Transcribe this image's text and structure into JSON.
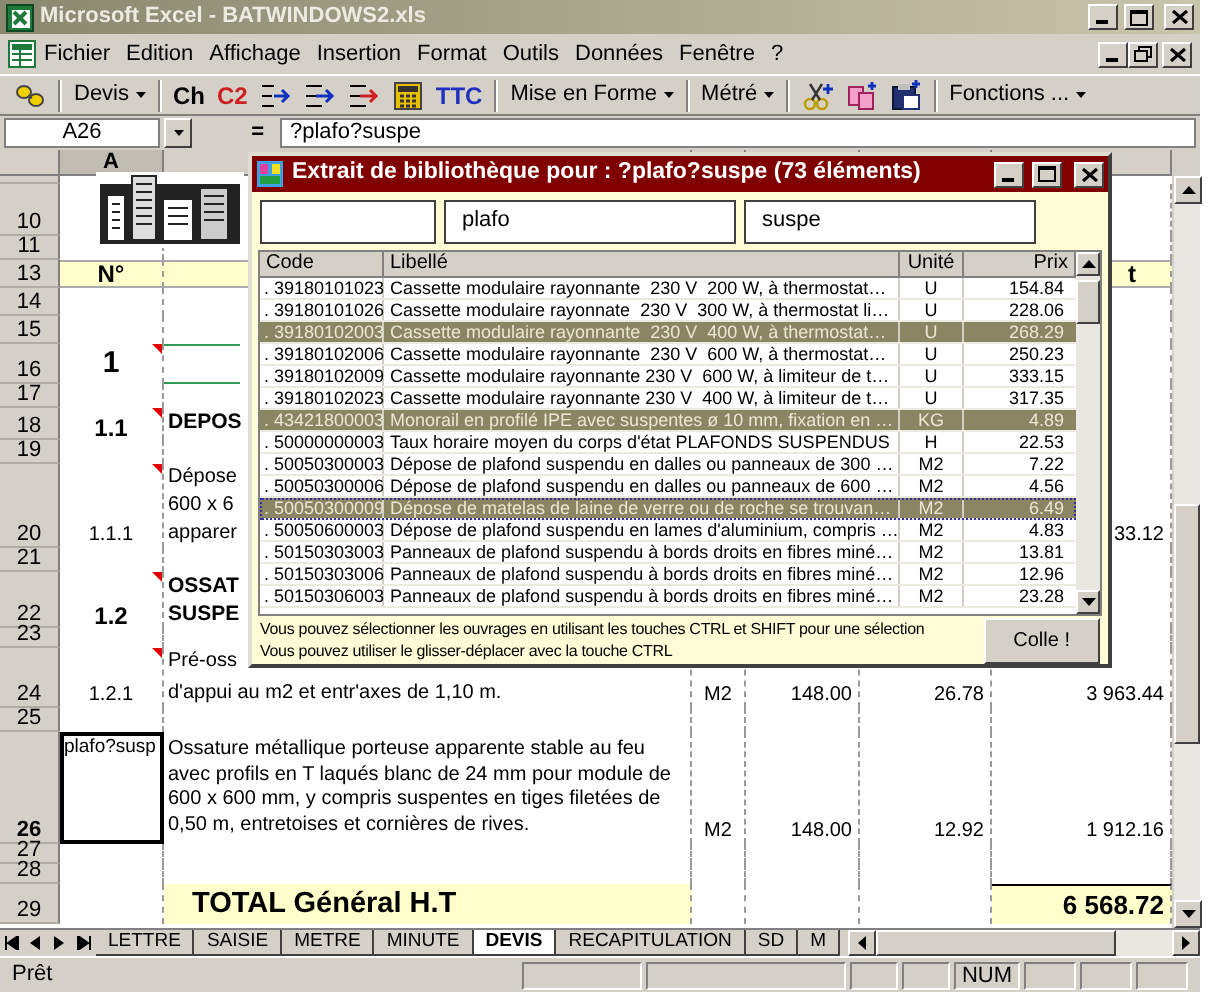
{
  "window": {
    "title": "Microsoft Excel - BATWINDOWS2.xls"
  },
  "menu": [
    "Fichier",
    "Edition",
    "Affichage",
    "Insertion",
    "Format",
    "Outils",
    "Données",
    "Fenêtre",
    "?"
  ],
  "toolbar": [
    {
      "kind": "icon"
    },
    {
      "kind": "separator"
    },
    {
      "kind": "dropdown",
      "label": "Devis"
    },
    {
      "kind": "separator"
    },
    {
      "kind": "text",
      "label": "Ch",
      "color": "#000000"
    },
    {
      "kind": "text",
      "label": "C2",
      "color": "#cc2020"
    },
    {
      "kind": "icon"
    },
    {
      "kind": "icon"
    },
    {
      "kind": "icon"
    },
    {
      "kind": "icon"
    },
    {
      "kind": "text",
      "label": "TTC",
      "color": "#2030c0"
    },
    {
      "kind": "separator"
    },
    {
      "kind": "dropdown",
      "label": "Mise en Forme"
    },
    {
      "kind": "separator"
    },
    {
      "kind": "dropdown",
      "label": "Métré"
    },
    {
      "kind": "separator"
    },
    {
      "kind": "icon"
    },
    {
      "kind": "icon"
    },
    {
      "kind": "icon"
    },
    {
      "kind": "separator"
    },
    {
      "kind": "dropdown",
      "label": "Fonctions ..."
    }
  ],
  "formula_bar": {
    "name_box": "A26",
    "equals": "=",
    "value": "?plafo?suspe"
  },
  "columns": [
    {
      "label": "A",
      "selected": true
    }
  ],
  "rows": [
    {
      "num": "10",
      "kind": "blank",
      "selected": false,
      "note": false
    },
    {
      "num": "11",
      "kind": "blank",
      "selected": false,
      "note": false
    },
    {
      "num": "13",
      "kind": "header",
      "selected": false,
      "note": false,
      "a": "N°",
      "f": "t"
    },
    {
      "num": "14",
      "kind": "blank",
      "selected": false,
      "note": false
    },
    {
      "num": "15",
      "kind": "blank",
      "selected": false,
      "note": false
    },
    {
      "num": "16",
      "kind": "chapter",
      "selected": false,
      "note": true,
      "a": "1"
    },
    {
      "num": "17",
      "kind": "blank",
      "selected": false,
      "note": false
    },
    {
      "num": "18",
      "kind": "section",
      "selected": false,
      "note": true,
      "a": "1.1",
      "lines": [
        "DEPOS"
      ]
    },
    {
      "num": "19",
      "kind": "blank",
      "selected": false,
      "note": false
    },
    {
      "num": "20",
      "kind": "item",
      "selected": false,
      "note": true,
      "a": "1.1.1",
      "lines": [
        "Dépose",
        "600 x 6",
        "apparer"
      ],
      "f": "33.12"
    },
    {
      "num": "21",
      "kind": "blank",
      "selected": false,
      "note": false
    },
    {
      "num": "22",
      "kind": "section",
      "selected": false,
      "note": true,
      "a": "1.2",
      "lines": [
        "OSSAT",
        "SUSPE"
      ]
    },
    {
      "num": "23",
      "kind": "blank",
      "selected": false,
      "note": false
    },
    {
      "num": "24",
      "kind": "item",
      "selected": false,
      "note": true,
      "a": "1.2.1",
      "lines": [
        "Pré-oss",
        "d'appui au m2 et entr'axes de 1,10 m."
      ],
      "c": "M2",
      "d": "148.00",
      "e": "26.78",
      "f": "3 963.44"
    },
    {
      "num": "25",
      "kind": "blank",
      "selected": false,
      "note": false
    },
    {
      "num": "26",
      "kind": "item",
      "selected": true,
      "note": false,
      "a": "plafo?susp",
      "text": "Ossature métallique porteuse apparente stable au feu avec profils en T laqués blanc de 24 mm pour module de 600 x 600 mm, y compris suspentes en tiges filetées de 0,50 m, entretoises et cornières de rives.",
      "c": "M2",
      "d": "148.00",
      "e": "12.92",
      "f": "1 912.16"
    },
    {
      "num": "27",
      "kind": "blank",
      "selected": false,
      "note": false
    },
    {
      "num": "28",
      "kind": "blank",
      "selected": false,
      "note": false
    },
    {
      "num": "29",
      "kind": "total",
      "selected": false,
      "note": false,
      "text": "TOTAL Général H.T",
      "f": "6 568.72"
    }
  ],
  "sheet_tabs": [
    {
      "label": "LETTRE",
      "selected": false
    },
    {
      "label": "SAISIE",
      "selected": false
    },
    {
      "label": "METRE",
      "selected": false
    },
    {
      "label": "MINUTE",
      "selected": false
    },
    {
      "label": "DEVIS",
      "selected": true
    },
    {
      "label": "RECAPITULATION",
      "selected": false
    },
    {
      "label": "SD",
      "selected": false
    },
    {
      "label": "M",
      "selected": false
    }
  ],
  "status_bar": {
    "text": "Prêt",
    "indicator": "NUM"
  },
  "dialog": {
    "title": "Extrait de bibliothèque pour : ?plafo?suspe  (73 éléments)",
    "filters": [
      "plafo",
      "suspe"
    ],
    "columns": [
      "Code",
      "Libellé",
      "Unité",
      "Prix"
    ],
    "rows": [
      {
        "code": ". 39180101023",
        "label": "Cassette modulaire rayonnante  230 V  200 W, à thermostat…",
        "unit": "U",
        "price": "154.84",
        "selected": false,
        "focused": false
      },
      {
        "code": ". 39180101026",
        "label": "Cassette modulaire rayonnate  230 V  300 W, à thermostat li…",
        "unit": "U",
        "price": "228.06",
        "selected": false,
        "focused": false
      },
      {
        "code": ". 39180102003",
        "label": "Cassette modulaire rayonnante  230 V  400 W, à thermostat…",
        "unit": "U",
        "price": "268.29",
        "selected": true,
        "focused": false
      },
      {
        "code": ". 39180102006",
        "label": "Cassette modulaire rayonnante  230 V  600 W, à thermostat…",
        "unit": "U",
        "price": "250.23",
        "selected": false,
        "focused": false
      },
      {
        "code": ". 39180102009",
        "label": "Cassette modulaire rayonnante 230 V  600 W, à limiteur de t…",
        "unit": "U",
        "price": "333.15",
        "selected": false,
        "focused": false
      },
      {
        "code": ". 39180102023",
        "label": "Cassette modulaire rayonnante 230 V  400 W, à limiteur de t…",
        "unit": "U",
        "price": "317.35",
        "selected": false,
        "focused": false
      },
      {
        "code": ". 43421800003",
        "label": "Monorail en profilé IPE avec suspentes ø 10 mm, fixation en …",
        "unit": "KG",
        "price": "4.89",
        "selected": true,
        "focused": false
      },
      {
        "code": ". 50000000003",
        "label": "Taux horaire moyen du corps d'état PLAFONDS SUSPENDUS",
        "unit": "H",
        "price": "22.53",
        "selected": false,
        "focused": false
      },
      {
        "code": ". 50050300003",
        "label": "Dépose de plafond suspendu en dalles ou panneaux de 300 …",
        "unit": "M2",
        "price": "7.22",
        "selected": false,
        "focused": false
      },
      {
        "code": ". 50050300006",
        "label": "Dépose de plafond suspendu en dalles ou panneaux de 600 …",
        "unit": "M2",
        "price": "4.56",
        "selected": false,
        "focused": false
      },
      {
        "code": ". 50050300009",
        "label": "Dépose de matelas de laine de verre ou de roche se trouvan…",
        "unit": "M2",
        "price": "6.49",
        "selected": true,
        "focused": true
      },
      {
        "code": ". 50050600003",
        "label": "Dépose de plafond suspendu en lames d'aluminium, compris …",
        "unit": "M2",
        "price": "4.83",
        "selected": false,
        "focused": false
      },
      {
        "code": ". 50150303003",
        "label": "Panneaux de plafond suspendu à bords droits en fibres miné…",
        "unit": "M2",
        "price": "13.81",
        "selected": false,
        "focused": false
      },
      {
        "code": ". 50150303006",
        "label": "Panneaux de plafond suspendu à bords droits en fibres miné…",
        "unit": "M2",
        "price": "12.96",
        "selected": false,
        "focused": false
      },
      {
        "code": ". 50150306003",
        "label": "Panneaux de plafond suspendu à bords droits en fibres miné…",
        "unit": "M2",
        "price": "23.28",
        "selected": false,
        "focused": false
      }
    ],
    "hints": [
      "Vous pouvez sélectionner les ouvrages en utilisant les touches CTRL et SHIFT pour une sélection",
      "Vous pouvez utiliser le glisser-déplacer avec la touche CTRL"
    ],
    "button": "Colle !"
  }
}
